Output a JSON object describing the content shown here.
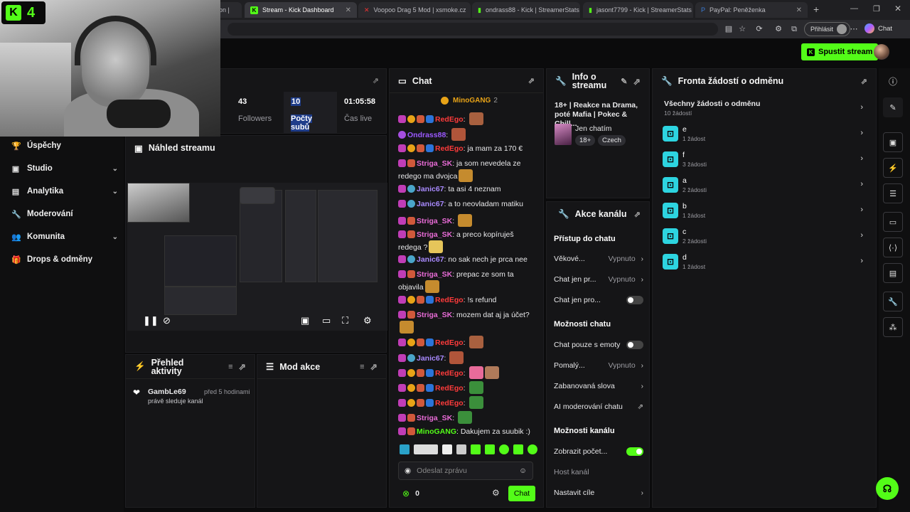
{
  "browser": {
    "tabs": [
      {
        "label": "on |",
        "active": false
      },
      {
        "label": "Stream - Kick Dashboard",
        "active": true
      },
      {
        "label": "Voopoo Drag 5 Mod | xsmoke.cz",
        "active": false
      },
      {
        "label": "ondrass88 - Kick | StreamerStats",
        "active": false
      },
      {
        "label": "jasont7799 - Kick | StreamerStats",
        "active": false
      },
      {
        "label": "PayPal: Peněženka",
        "active": false
      }
    ],
    "signin_label": "Přihlásit",
    "chat_label": "Chat",
    "new_tab": "+",
    "menu": "⋯"
  },
  "header": {
    "go_live": "Spustit stream"
  },
  "webcam": {
    "badge_number": "4"
  },
  "nav": [
    {
      "label": "Úspěchy",
      "icon": "trophy-icon",
      "glyph": "🏆",
      "chev": false
    },
    {
      "label": "Studio",
      "icon": "studio-icon",
      "glyph": "▣",
      "chev": true
    },
    {
      "label": "Analytika",
      "icon": "analytics-icon",
      "glyph": "▤",
      "chev": true
    },
    {
      "label": "Moderování",
      "icon": "wrench-icon",
      "glyph": "🔧",
      "chev": false
    },
    {
      "label": "Komunita",
      "icon": "community-icon",
      "glyph": "👥",
      "chev": true
    },
    {
      "label": "Drops & odměny",
      "icon": "gift-icon",
      "glyph": "🎁",
      "chev": false
    }
  ],
  "stats": [
    {
      "value": "43",
      "label": "Followers"
    },
    {
      "value": "10",
      "label": "Počty subů"
    },
    {
      "value": "01:05:58",
      "label": "Čas live"
    }
  ],
  "preview": {
    "title": "Náhled streamu"
  },
  "activity": {
    "title": "Přehled aktivity",
    "items": [
      {
        "user": "GambLe69",
        "time": "před 5 hodinami",
        "text": "právě sleduje kanál"
      }
    ]
  },
  "modactions": {
    "title": "Mod akce"
  },
  "chat": {
    "title": "Chat",
    "pinned": "MinoGANG",
    "pinned_count": "2",
    "messages": [
      {
        "user": "RedEgo",
        "text": "",
        "ucls": "u-red"
      },
      {
        "user": "Ondrass88",
        "text": "",
        "ucls": "u-purple"
      },
      {
        "user": "RedEgo",
        "text": "ja mam za 170 €",
        "ucls": "u-red"
      },
      {
        "user": "Striga_SK",
        "text": "ja som nevedela ze redego ma dvojca",
        "ucls": "u-pink"
      },
      {
        "user": "Janic67",
        "text": "ta asi 4 neznam",
        "ucls": "u-janic"
      },
      {
        "user": "Janic67",
        "text": "a to neovladam matiku",
        "ucls": "u-janic"
      },
      {
        "user": "Striga_SK",
        "text": "",
        "ucls": "u-pink"
      },
      {
        "user": "Striga_SK",
        "text": "a preco kopíruješ redega ?",
        "ucls": "u-pink"
      },
      {
        "user": "Janic67",
        "text": "no sak nech je prca nee",
        "ucls": "u-janic"
      },
      {
        "user": "Striga_SK",
        "text": "prepac ze som ta objavila",
        "ucls": "u-pink"
      },
      {
        "user": "RedEgo",
        "text": "!s refund",
        "ucls": "u-red"
      },
      {
        "user": "Striga_SK",
        "text": "mozem dat aj ja účet?",
        "ucls": "u-pink"
      },
      {
        "user": "RedEgo",
        "text": "",
        "ucls": "u-red"
      },
      {
        "user": "Janic67",
        "text": "",
        "ucls": "u-janic"
      },
      {
        "user": "RedEgo",
        "text": "",
        "ucls": "u-red"
      },
      {
        "user": "RedEgo",
        "text": "",
        "ucls": "u-red"
      },
      {
        "user": "RedEgo",
        "text": "",
        "ucls": "u-red"
      },
      {
        "user": "Striga_SK",
        "text": "",
        "ucls": "u-pink"
      },
      {
        "user": "MinoGANG",
        "text": "Dakujem za suubik :)",
        "ucls": "u-green"
      }
    ],
    "placeholder": "Odeslat zprávu",
    "points": "0",
    "send_label": "Chat"
  },
  "info": {
    "title": "Info o streamu",
    "stream_title": "18+ | Reakce na Drama, poté Mafia | Pokec & Chill...",
    "category": "Jen chatím",
    "tags": [
      "18+",
      "Czech"
    ]
  },
  "channel": {
    "title": "Akce kanálu",
    "sec_access": "Přístup do chatu",
    "age": {
      "label": "Věkové...",
      "value": "Vypnuto"
    },
    "chat_only1": {
      "label": "Chat jen pr...",
      "value": "Vypnuto"
    },
    "chat_only2": {
      "label": "Chat jen pro..."
    },
    "sec_options": "Možnosti chatu",
    "emotes_only": {
      "label": "Chat pouze s emoty"
    },
    "slow": {
      "label": "Pomalý...",
      "value": "Vypnuto"
    },
    "banned_words": {
      "label": "Zabanovaná slova"
    },
    "ai_mod": {
      "label": "AI moderování chatu"
    },
    "sec_channel": "Možnosti kanálu",
    "show_count": {
      "label": "Zobrazit počet..."
    },
    "host": {
      "label": "Host kanál"
    },
    "goals": {
      "label": "Nastavit cíle"
    }
  },
  "rewards": {
    "title": "Fronta žádostí o odměnu",
    "all_label": "Všechny žádosti o odměnu",
    "all_count": "10 žádostí",
    "items": [
      {
        "name": "e",
        "count": "1 žádost"
      },
      {
        "name": "f",
        "count": "3 žádosti"
      },
      {
        "name": "a",
        "count": "2 žádosti"
      },
      {
        "name": "b",
        "count": "1 žádost"
      },
      {
        "name": "c",
        "count": "2 žádosti"
      },
      {
        "name": "d",
        "count": "1 žádost"
      }
    ]
  }
}
